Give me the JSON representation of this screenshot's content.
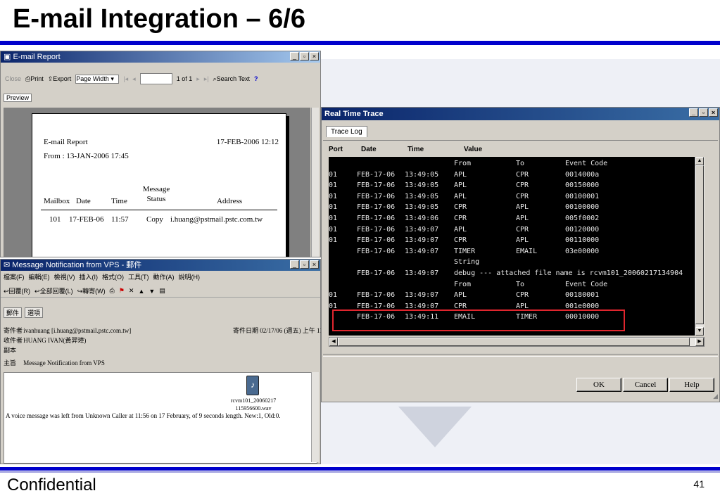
{
  "slide": {
    "title": "E-mail Integration – 6/6",
    "footer_left": "Confidential",
    "page_number": "41"
  },
  "email_report": {
    "window_title": "E-mail Report",
    "toolbar": {
      "close": "Close",
      "print": "Print",
      "export": "Export",
      "zoom": "Page Width",
      "page_of": "1 of 1",
      "search_text": "Search Text",
      "help": "?"
    },
    "tab": "Preview",
    "report": {
      "title": "E-mail Report",
      "timestamp": "17-FEB-2006 12:12",
      "from_line": "From : 13-JAN-2006 17:45",
      "headers": [
        "Mailbox",
        "Date",
        "Time",
        "Message Status",
        "Address"
      ],
      "row": [
        "101",
        "17-FEB-06",
        "11:57",
        "Copy",
        "i.huang@pstmail.pstc.com.tw"
      ]
    }
  },
  "message_window": {
    "window_title": "Message Notification from VPS - 郵件",
    "menu": [
      "檔案(F)",
      "編輯(E)",
      "檢視(V)",
      "插入(I)",
      "格式(O)",
      "工具(T)",
      "動作(A)",
      "說明(H)"
    ],
    "toolbar": [
      "回覆(R)",
      "全部回覆(L)",
      "轉寄(W)"
    ],
    "tabs": [
      "郵件",
      "選項"
    ],
    "fields": {
      "from_label": "寄件者",
      "from_value": "ivanhuang [i.huang@pstmail.pstc.com.tw]",
      "sent_label": "寄件日期",
      "sent_value": "02/17/06 (週五) 上午 11:57",
      "to_label": "收件者",
      "to_value": "HUANG IVAN(黃羿璋)",
      "cc_label": "副本",
      "subject_label": "主旨",
      "subject_value": "Message Notification from VPS"
    },
    "attachment_name_1": "rcvm101_20060217",
    "attachment_name_2": "115956600.wav",
    "body_text": "A voice message was left from Unknown Caller at 11:56 on 17 February, of 9 seconds length. New:1, Old:0."
  },
  "trace_window": {
    "window_title": "Real Time Trace",
    "tab": "Trace Log",
    "columns": [
      "Port",
      "Date",
      "Time",
      "Value"
    ],
    "lines": [
      {
        "port": "",
        "date": "",
        "time": "",
        "v1": "From",
        "v2": "To",
        "v3": "Event Code"
      },
      {
        "port": "01",
        "date": "FEB-17-06",
        "time": "13:49:05",
        "v1": "APL",
        "v2": "CPR",
        "v3": "0014000a"
      },
      {
        "port": "01",
        "date": "FEB-17-06",
        "time": "13:49:05",
        "v1": "APL",
        "v2": "CPR",
        "v3": "00150000"
      },
      {
        "port": "01",
        "date": "FEB-17-06",
        "time": "13:49:05",
        "v1": "APL",
        "v2": "CPR",
        "v3": "00100001"
      },
      {
        "port": "01",
        "date": "FEB-17-06",
        "time": "13:49:05",
        "v1": "CPR",
        "v2": "APL",
        "v3": "00100000"
      },
      {
        "port": "01",
        "date": "FEB-17-06",
        "time": "13:49:06",
        "v1": "CPR",
        "v2": "APL",
        "v3": "005f0002"
      },
      {
        "port": "01",
        "date": "FEB-17-06",
        "time": "13:49:07",
        "v1": "APL",
        "v2": "CPR",
        "v3": "00120000"
      },
      {
        "port": "01",
        "date": "FEB-17-06",
        "time": "13:49:07",
        "v1": "CPR",
        "v2": "APL",
        "v3": "00110000"
      },
      {
        "port": "",
        "date": "FEB-17-06",
        "time": "13:49:07",
        "v1": "TIMER",
        "v2": "EMAIL",
        "v3": "03e00000"
      },
      {
        "port": "",
        "date": "",
        "time": "",
        "v1": "String",
        "v2": "",
        "v3": ""
      },
      {
        "port": "",
        "date": "FEB-17-06",
        "time": "13:49:07",
        "v1": "debug --- attached file name is rcvm101_20060217134904",
        "v2": "",
        "v3": ""
      },
      {
        "port": "",
        "date": "",
        "time": "",
        "v1": "From",
        "v2": "To",
        "v3": "Event Code"
      },
      {
        "port": "01",
        "date": "FEB-17-06",
        "time": "13:49:07",
        "v1": "APL",
        "v2": "CPR",
        "v3": "00180001"
      },
      {
        "port": "01",
        "date": "FEB-17-06",
        "time": "13:49:07",
        "v1": "CPR",
        "v2": "APL",
        "v3": "001e0000"
      },
      {
        "port": "",
        "date": "FEB-17-06",
        "time": "13:49:11",
        "v1": "EMAIL",
        "v2": "TIMER",
        "v3": "00010000"
      }
    ],
    "buttons": {
      "ok": "OK",
      "cancel": "Cancel",
      "help": "Help"
    }
  }
}
